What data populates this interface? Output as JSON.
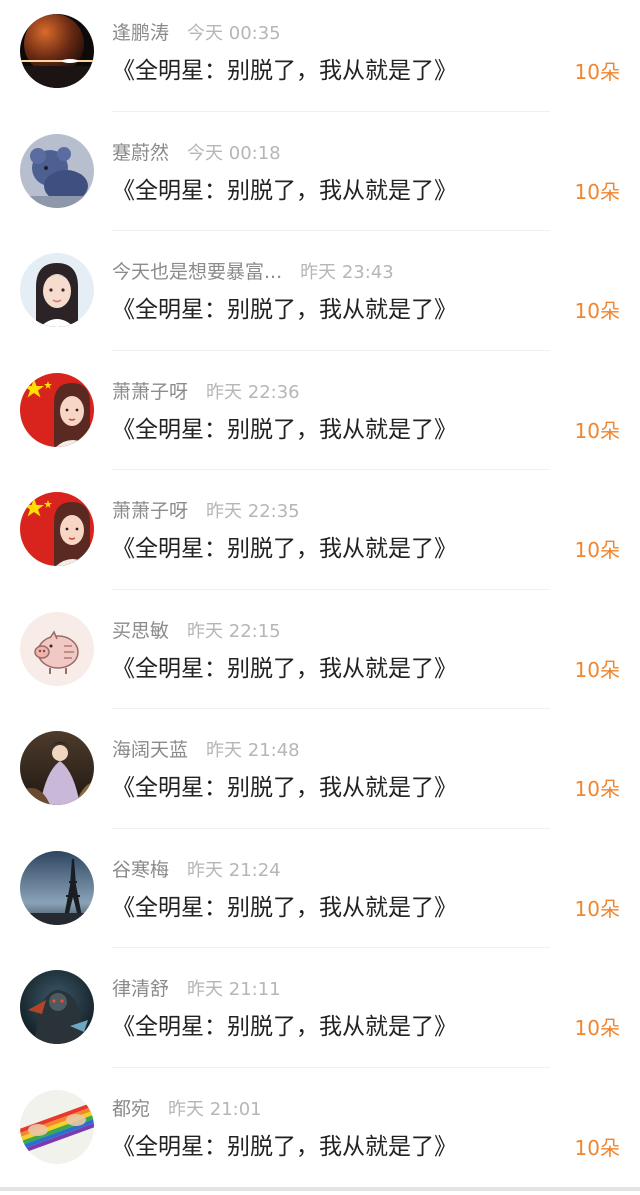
{
  "colors": {
    "name": "#8b8b8b",
    "time": "#b6b6b6",
    "gift": "#222222",
    "amount": "#f0852d"
  },
  "rows": [
    {
      "name": "逢鹏涛",
      "time": "今天 00:35",
      "gift": "《全明星：别脱了，我从就是了》",
      "amount": "10朵",
      "avatar_icon": "planet-avatar-icon"
    },
    {
      "name": "蹇蔚然",
      "time": "今天 00:18",
      "gift": "《全明星：别脱了，我从就是了》",
      "amount": "10朵",
      "avatar_icon": "plush-toy-avatar-icon"
    },
    {
      "name": "今天也是想要暴富...",
      "time": "昨天 23:43",
      "gift": "《全明星：别脱了，我从就是了》",
      "amount": "10朵",
      "avatar_icon": "girl-portrait-avatar-icon"
    },
    {
      "name": "萧萧子呀",
      "time": "昨天 22:36",
      "gift": "《全明星：别脱了，我从就是了》",
      "amount": "10朵",
      "avatar_icon": "flag-portrait-avatar-icon"
    },
    {
      "name": "萧萧子呀",
      "time": "昨天 22:35",
      "gift": "《全明星：别脱了，我从就是了》",
      "amount": "10朵",
      "avatar_icon": "flag-portrait-avatar-icon"
    },
    {
      "name": "买思敏",
      "time": "昨天 22:15",
      "gift": "《全明星：别脱了，我从就是了》",
      "amount": "10朵",
      "avatar_icon": "pig-sketch-avatar-icon"
    },
    {
      "name": "海阔天蓝",
      "time": "昨天 21:48",
      "gift": "《全明星：别脱了，我从就是了》",
      "amount": "10朵",
      "avatar_icon": "painting-avatar-icon"
    },
    {
      "name": "谷寒梅",
      "time": "昨天 21:24",
      "gift": "《全明星：别脱了，我从就是了》",
      "amount": "10朵",
      "avatar_icon": "eiffel-tower-avatar-icon"
    },
    {
      "name": "律清舒",
      "time": "昨天 21:11",
      "gift": "《全明星：别脱了，我从就是了》",
      "amount": "10朵",
      "avatar_icon": "armored-hero-avatar-icon"
    },
    {
      "name": "都宛",
      "time": "昨天 21:01",
      "gift": "《全明星：别脱了，我从就是了》",
      "amount": "10朵",
      "avatar_icon": "rainbow-hands-avatar-icon"
    }
  ]
}
